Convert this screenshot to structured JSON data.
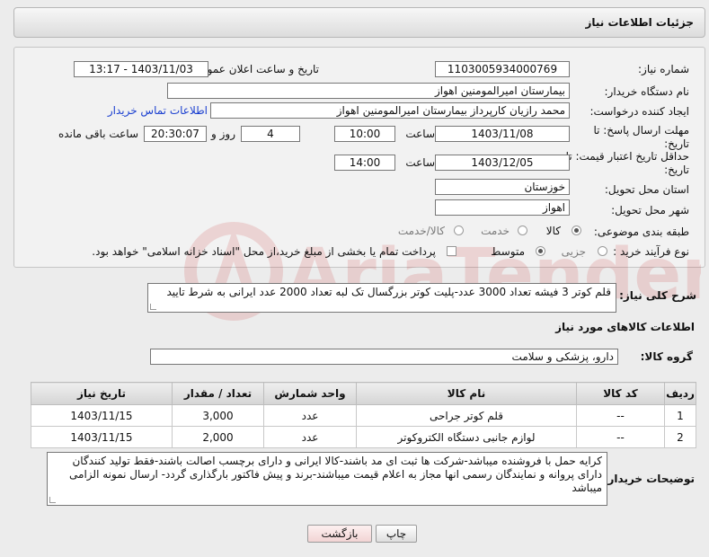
{
  "header": {
    "title": "جزئیات اطلاعات نیاز"
  },
  "fields": {
    "need_number_label": "شماره نیاز:",
    "need_number": "1103005934000769",
    "announce_label": "تاریخ و ساعت اعلان عمومی:",
    "announce_value": "1403/11/03 - 13:17",
    "buyer_org_label": "نام دستگاه خریدار:",
    "buyer_org": "بیمارستان امیرالمومنین اهواز",
    "creator_label": "ایجاد کننده درخواست:",
    "creator": "محمد رازیان کارپرداز بیمارستان امیرالمومنین اهواز",
    "contact_link": "اطلاعات تماس خریدار",
    "deadline_label_1": "مهلت ارسال پاسخ: تا",
    "deadline_label_2": "تاریخ:",
    "deadline_date": "1403/11/08",
    "time_label": "ساعت",
    "deadline_time": "10:00",
    "days_value": "4",
    "days_label": "روز و",
    "remaining_time": "20:30:07",
    "remaining_label": "ساعت باقی مانده",
    "validity_label_1": "حداقل تاریخ اعتبار قیمت: تا",
    "validity_label_2": "تاریخ:",
    "validity_date": "1403/12/05",
    "validity_time": "14:00",
    "province_label": "استان محل تحویل:",
    "province": "خوزستان",
    "city_label": "شهر محل تحویل:",
    "city": "اهواز",
    "category_label": "طبقه بندی موضوعی:",
    "category_options": [
      "کالا",
      "خدمت",
      "کالا/خدمت"
    ],
    "process_label": "نوع فرآیند خرید :",
    "process_options": [
      "جزیی",
      "متوسط"
    ],
    "payment_text": "پرداخت تمام یا بخشی از مبلغ خرید،از محل \"اسناد خزانه اسلامی\" خواهد بود."
  },
  "summary": {
    "label": "شرح کلی نیاز:",
    "text": "قلم کوتر 3 فیشه تعداد 3000 عدد-پلیت کوتر بزرگسال تک لبه تعداد 2000 عدد ایرانی به شرط تایید"
  },
  "goods_section": {
    "title": "اطلاعات کالاهای مورد نیاز",
    "group_label": "گروه کالا:",
    "group_value": "دارو، پزشکی و سلامت",
    "columns": [
      "ردیف",
      "کد کالا",
      "نام کالا",
      "واحد شمارش",
      "تعداد / مقدار",
      "تاریخ نیاز"
    ],
    "rows": [
      {
        "row": "1",
        "code": "--",
        "name": "قلم کوتر جراحی",
        "unit": "عدد",
        "qty": "3,000",
        "date": "1403/11/15"
      },
      {
        "row": "2",
        "code": "--",
        "name": "لوازم جانبی دستگاه الکتروکوتر",
        "unit": "عدد",
        "qty": "2,000",
        "date": "1403/11/15"
      }
    ]
  },
  "buyer_notes": {
    "label": "توضیحات خریدار:",
    "text": "کرایه حمل با فروشنده میباشد-شرکت ها ثبت ای مد باشند-کالا ایرانی و دارای برچسب اصالت باشند-فقط تولید کنندگان دارای پروانه و نمایندگان رسمی انها مجاز به اعلام قیمت میباشند-برند و پیش فاکتور بارگذاری گردد- ارسال نمونه الزامی میباشد"
  },
  "buttons": {
    "print": "چاپ",
    "back": "بازگشت"
  },
  "watermark": {
    "text": "AriaTender.net"
  },
  "colors": {
    "link": "#1a3fd0",
    "back_button_bg": "#f7dede"
  }
}
